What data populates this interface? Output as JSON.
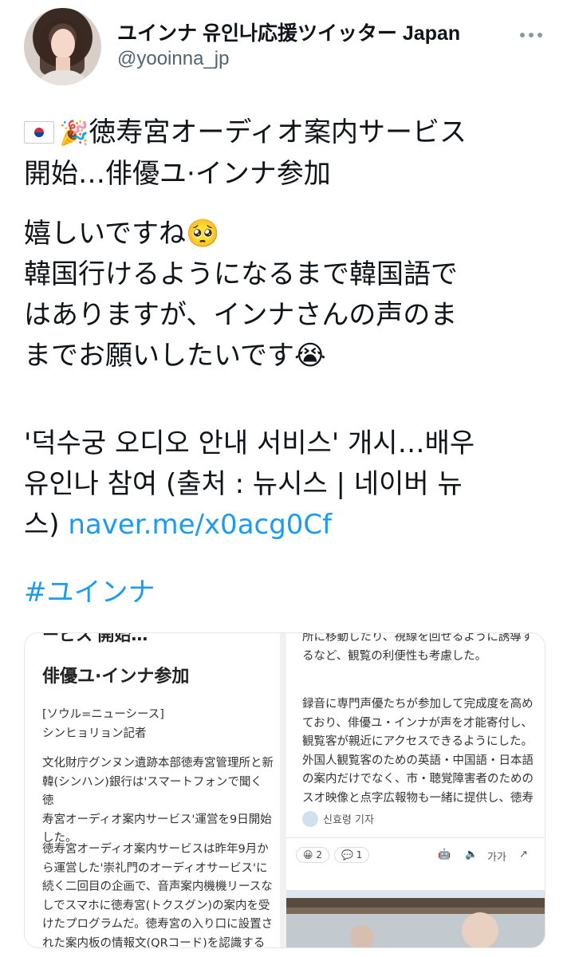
{
  "author": {
    "name": "ユインナ 유인나応援ツイッター Japan",
    "handle": "@yooinna_jp"
  },
  "tweet": {
    "line1": "徳寿宮オーディオ案内サービス\n開始…俳優ユ·インナ参加",
    "line2": "嬉しいですね🥺\n韓国行けるようになるまで韓国語で\nはありますが、インナさんの声のま\nまでお願いしたいです😭",
    "line3": "'덕수궁 오디오 안내 서비스' 개시…배우\n유인나 참여 (출처 : 뉴시스 | 네이버 뉴\n스) ",
    "link": "naver.me/x0acg0Cf",
    "hashtag": "#ユインナ",
    "flag_emoji": "🇰🇷",
    "party_emoji": "🎉"
  },
  "article": {
    "cut_header": "ービス'開始…",
    "title": "俳優ユ·インナ参加",
    "dateline": "[ソウル=ニューシース]\nシンヒョリョン記者",
    "para1": "文化財庁グンヌン遺跡本部徳寿宮管理所と新\n韓(シンハン)銀行は'スマートフォンで聞く徳\n寿宮オーディオ案内サービス'運営を9日開始\nした。",
    "para2": "徳寿宮オーディオ案内サービスは昨年9月か\nら運営した'崇礼門のオーディオサービス'に\n続く二回目の企画で、音声案内機機リースな\nしでスマホに徳寿宮(トクスグン)の案内を受\nけたプログラムだ。徳寿宮の入り口に設置さ\nれた案内板の情報文(QRコード)を認識する",
    "right_para1": "所に移動したり、視線を回せるように誘導す\nるなど、観覧の利便性も考慮した。",
    "right_para2": "録音に専門声優たちが参加して完成度を高め\nており、俳優ユ・インナが声を才能寄付し、\n観覧客が親近にアクセスできるようにした。\n外国人観覧客のための英語・中国語・日本語\nの案内だけでなく、市・聴覚障害者のための\nスオ映像と点字広報物も一緒に提供し、徳寿",
    "reporter": "신효령 기자",
    "reaction_count": "2",
    "comment_count": "1",
    "font_size_label": "가가"
  }
}
